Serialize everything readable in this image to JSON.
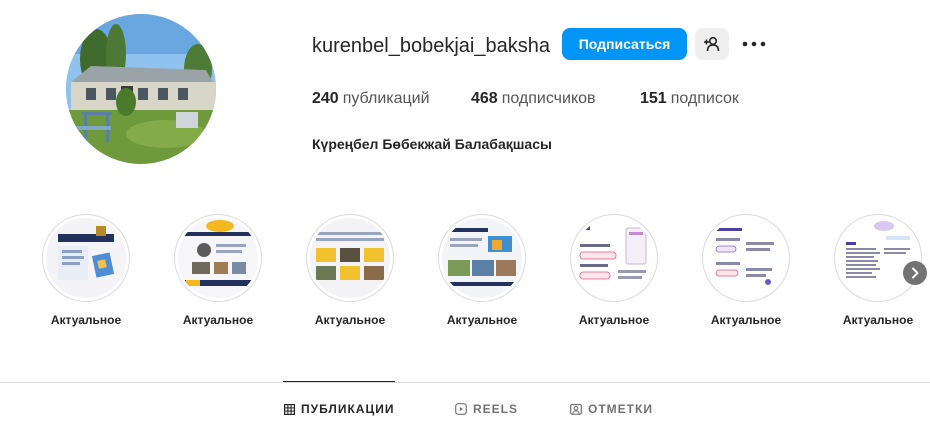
{
  "profile": {
    "username": "kurenbel_bobekjai_baksha",
    "full_name": "Күреңбел Бөбекжай Балабақшасы",
    "follow_label": "Подписаться",
    "stats": {
      "posts_count": "240",
      "posts_label": "публикаций",
      "followers_count": "468",
      "followers_label": "подписчиков",
      "following_count": "151",
      "following_label": "подписок"
    }
  },
  "highlights": [
    {
      "label": "Актуальное",
      "thumb": "presentation-slide-blue"
    },
    {
      "label": "Актуальное",
      "thumb": "presentation-slide-navy-yellow"
    },
    {
      "label": "Актуальное",
      "thumb": "presentation-slide-yellow-photos"
    },
    {
      "label": "Актуальное",
      "thumb": "presentation-slide-photos"
    },
    {
      "label": "Актуальное",
      "thumb": "chat-screenshot"
    },
    {
      "label": "Актуальное",
      "thumb": "chat-screenshot-2"
    },
    {
      "label": "Актуальное",
      "thumb": "text-document"
    }
  ],
  "tabs": [
    {
      "label": "ПУБЛИКАЦИИ",
      "icon": "grid-icon",
      "active": true
    },
    {
      "label": "REELS",
      "icon": "reels-icon",
      "active": false
    },
    {
      "label": "ОТМЕТКИ",
      "icon": "tagged-icon",
      "active": false
    }
  ],
  "colors": {
    "follow_button": "#0095f6",
    "text_primary": "#262626",
    "text_secondary": "#737373",
    "divider": "#dbdbdb"
  }
}
